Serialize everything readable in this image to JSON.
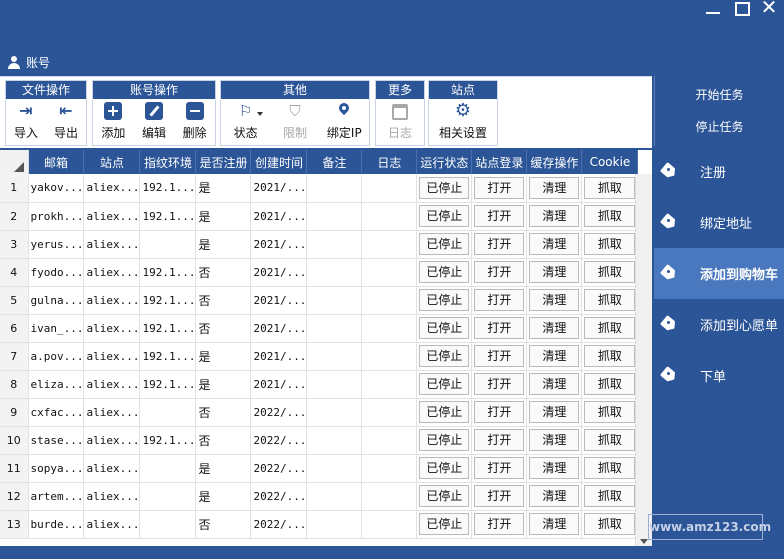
{
  "account": {
    "label": "账号"
  },
  "toolbar": {
    "groups": [
      {
        "title": "文件操作",
        "buttons": [
          {
            "label": "导入"
          },
          {
            "label": "导出"
          }
        ]
      },
      {
        "title": "账号操作",
        "buttons": [
          {
            "label": "添加"
          },
          {
            "label": "编辑"
          },
          {
            "label": "删除"
          }
        ]
      },
      {
        "title": "其他",
        "buttons": [
          {
            "label": "状态"
          },
          {
            "label": "限制"
          },
          {
            "label": "绑定IP"
          }
        ]
      },
      {
        "title": "更多",
        "buttons": [
          {
            "label": "日志"
          }
        ]
      },
      {
        "title": "站点",
        "buttons": [
          {
            "label": "相关设置"
          }
        ]
      }
    ]
  },
  "tasks": {
    "start": "开始任务",
    "stop": "停止任务"
  },
  "nav": {
    "items": [
      {
        "label": "注册"
      },
      {
        "label": "绑定地址"
      },
      {
        "label": "添加到购物车"
      },
      {
        "label": "添加到心愿单"
      },
      {
        "label": "下单"
      }
    ]
  },
  "grid": {
    "headers": [
      "邮箱",
      "站点",
      "指纹环境",
      "是否注册",
      "创建时间",
      "备注",
      "日志",
      "运行状态",
      "站点登录",
      "缓存操作",
      "Cookie"
    ],
    "rows": [
      [
        "1",
        "yakov...",
        "aliex...",
        "192.1...",
        "是",
        "2021/...",
        "",
        "",
        "已停止",
        "打开",
        "清理",
        "抓取"
      ],
      [
        "2",
        "prokh...",
        "aliex...",
        "192.1...",
        "是",
        "2021/...",
        "",
        "",
        "已停止",
        "打开",
        "清理",
        "抓取"
      ],
      [
        "3",
        "yerus...",
        "aliex...",
        "",
        "是",
        "2021/...",
        "",
        "",
        "已停止",
        "打开",
        "清理",
        "抓取"
      ],
      [
        "4",
        "fyodo...",
        "aliex...",
        "192.1...",
        "否",
        "2021/...",
        "",
        "",
        "已停止",
        "打开",
        "清理",
        "抓取"
      ],
      [
        "5",
        "gulna...",
        "aliex...",
        "192.1...",
        "否",
        "2021/...",
        "",
        "",
        "已停止",
        "打开",
        "清理",
        "抓取"
      ],
      [
        "6",
        "ivan_...",
        "aliex...",
        "192.1...",
        "否",
        "2021/...",
        "",
        "",
        "已停止",
        "打开",
        "清理",
        "抓取"
      ],
      [
        "7",
        "a.pov...",
        "aliex...",
        "192.1...",
        "是",
        "2021/...",
        "",
        "",
        "已停止",
        "打开",
        "清理",
        "抓取"
      ],
      [
        "8",
        "eliza...",
        "aliex...",
        "192.1...",
        "是",
        "2021/...",
        "",
        "",
        "已停止",
        "打开",
        "清理",
        "抓取"
      ],
      [
        "9",
        "cxfac...",
        "aliex...",
        "",
        "否",
        "2022/...",
        "",
        "",
        "已停止",
        "打开",
        "清理",
        "抓取"
      ],
      [
        "10",
        "stase...",
        "aliex...",
        "192.1...",
        "否",
        "2022/...",
        "",
        "",
        "已停止",
        "打开",
        "清理",
        "抓取"
      ],
      [
        "11",
        "sopya...",
        "aliex...",
        "",
        "是",
        "2022/...",
        "",
        "",
        "已停止",
        "打开",
        "清理",
        "抓取"
      ],
      [
        "12",
        "artem...",
        "aliex...",
        "",
        "是",
        "2022/...",
        "",
        "",
        "已停止",
        "打开",
        "清理",
        "抓取"
      ],
      [
        "13",
        "burde...",
        "aliex...",
        "",
        "否",
        "2022/...",
        "",
        "",
        "已停止",
        "打开",
        "清理",
        "抓取"
      ]
    ]
  },
  "watermark": "www.amz123.com"
}
